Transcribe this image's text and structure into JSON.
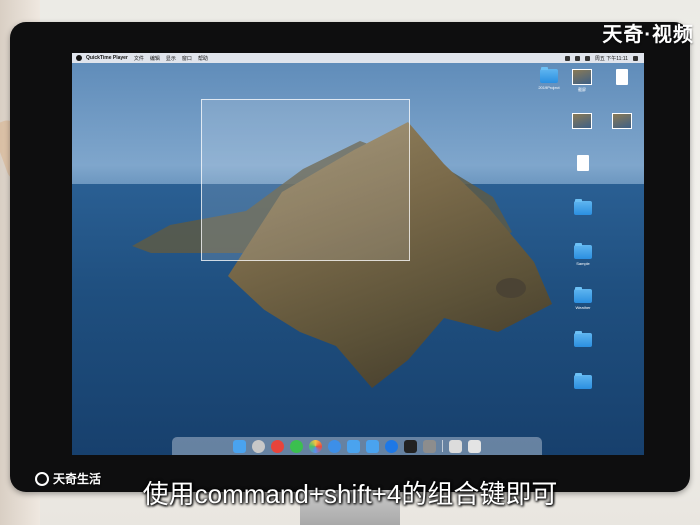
{
  "menubar": {
    "app_name": "QuickTime Player",
    "items": [
      "文件",
      "编辑",
      "显示",
      "窗口",
      "帮助"
    ],
    "clock": "周五 下午11:11"
  },
  "desktop_icons": [
    {
      "label": "2019Project",
      "kind": "folder"
    },
    {
      "label": "截屏",
      "kind": "thumb"
    },
    {
      "label": "",
      "kind": "doc"
    },
    {
      "label": "",
      "kind": "thumb"
    },
    {
      "label": "",
      "kind": "thumb"
    },
    {
      "label": "",
      "kind": "doc"
    },
    {
      "label": "",
      "kind": "folder"
    },
    {
      "label": "Sample",
      "kind": "folder"
    },
    {
      "label": "Weather",
      "kind": "folder"
    },
    {
      "label": "",
      "kind": "folder"
    },
    {
      "label": "",
      "kind": "folder"
    }
  ],
  "dock": {
    "apps": [
      "finder-icon",
      "launchpad-icon",
      "weibo-icon",
      "wechat-icon",
      "photos-icon",
      "safari-icon",
      "folder-icon",
      "folder-icon",
      "appstore-icon",
      "terminal-icon",
      "system-prefs-icon",
      "preview-icon",
      "trash-icon"
    ]
  },
  "brand_top": "天奇·视频",
  "brand_bottom": "天奇生活",
  "subtitle": "使用command+shift+4的组合键即可",
  "colors": {
    "folder": "#2b8fe0",
    "selection": "rgba(255,255,255,0.14)",
    "subtitle": "#ffffff"
  }
}
